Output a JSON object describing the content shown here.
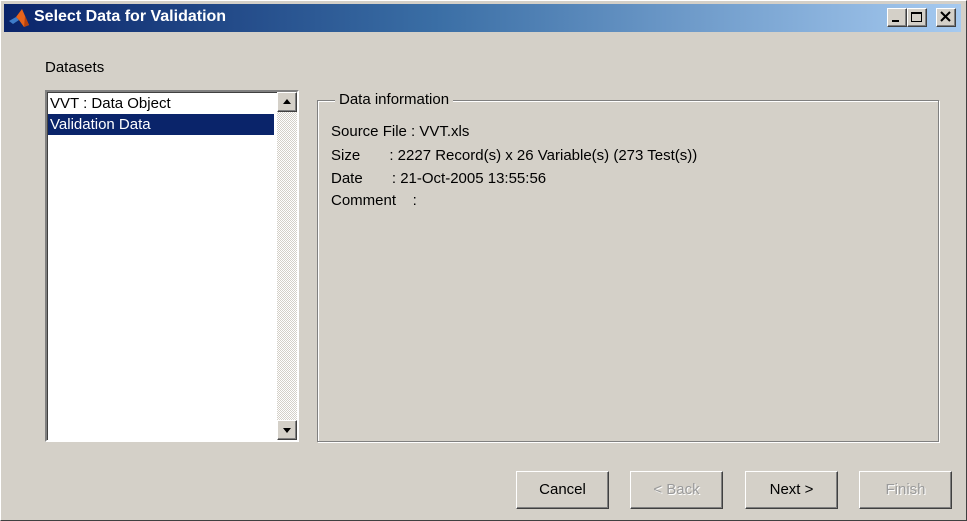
{
  "window": {
    "title": "Select Data for Validation",
    "title_gradient": [
      "#0a246a",
      "#a6caf0"
    ],
    "face_color": "#d4d0c8"
  },
  "titlebar_buttons": [
    "minimize-icon",
    "maximize-icon",
    "close-icon"
  ],
  "datasets": {
    "label": "Datasets",
    "items": [
      {
        "label": "VVT : Data Object",
        "selected": false
      },
      {
        "label": "Validation Data",
        "selected": true
      }
    ],
    "selection_color": "#0a246a"
  },
  "data_info": {
    "title": "Data information",
    "lines": [
      "Source File : VVT.xls",
      "Size       : 2227 Record(s) x 26 Variable(s) (273 Test(s))",
      "Date       : 21-Oct-2005 13:55:56",
      "Comment    :"
    ]
  },
  "buttons": {
    "cancel": "Cancel",
    "back": "< Back",
    "next": "Next >",
    "finish": "Finish"
  }
}
